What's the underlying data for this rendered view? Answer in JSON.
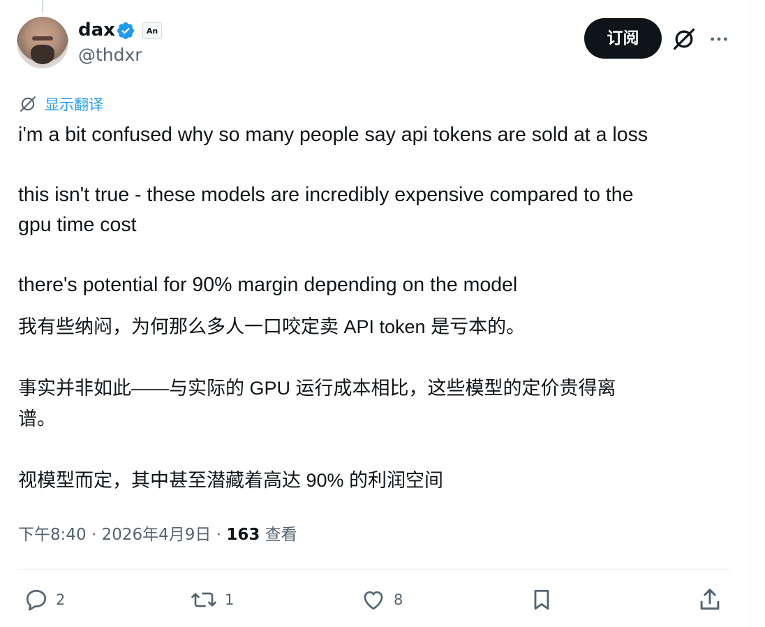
{
  "author": {
    "name": "dax",
    "handle": "@thdxr",
    "affiliate_badge": "An",
    "verified": true
  },
  "header": {
    "subscribe_label": "订阅",
    "icons": [
      "verified-icon",
      "grok-icon",
      "more-icon"
    ]
  },
  "translate": {
    "label": "显示翻译",
    "icon": "grok-translate-icon"
  },
  "tweet": {
    "line1": "i'm a bit confused why so many people say api tokens are sold at a loss",
    "line2": "this isn't true - these models are incredibly expensive compared to the",
    "line3": "gpu time cost",
    "line4": "there's potential for 90% margin depending on the model"
  },
  "translation": {
    "line1": "我有些纳闷，为何那么多人一口咬定卖 API token 是亏本的。",
    "line2": "事实并非如此——与实际的 GPU 运行成本相比，这些模型的定价贵得离",
    "line3": "谱。",
    "line4": "视模型而定，其中甚至潜藏着高达 90% 的利润空间"
  },
  "meta": {
    "time": "下午8:40",
    "separator": "·",
    "date": "2026年4月9日",
    "views_count": "163",
    "views_label": "查看"
  },
  "actions": {
    "replies": "2",
    "reposts": "1",
    "likes": "8"
  },
  "colors": {
    "accent": "#1d9bf0",
    "text": "#0f1419",
    "secondary": "#536471",
    "divider": "#eff3f4"
  }
}
